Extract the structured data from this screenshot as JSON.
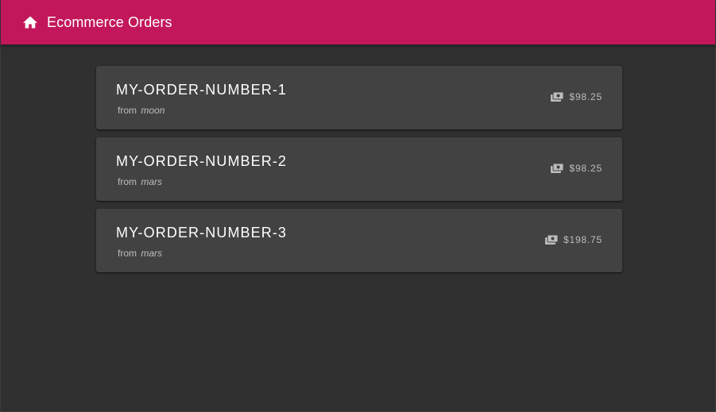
{
  "toolbar": {
    "title": "Ecommerce Orders",
    "icon": "home-icon",
    "color": "#c2185b"
  },
  "orders": [
    {
      "number": "MY-ORDER-NUMBER-1",
      "from_label": "from",
      "origin": "moon",
      "price": "$98.25",
      "icon": "money-icon"
    },
    {
      "number": "MY-ORDER-NUMBER-2",
      "from_label": "from",
      "origin": "mars",
      "price": "$98.25",
      "icon": "money-icon"
    },
    {
      "number": "MY-ORDER-NUMBER-3",
      "from_label": "from",
      "origin": "mars",
      "price": "$198.75",
      "icon": "money-icon"
    }
  ],
  "colors": {
    "background": "#303030",
    "card": "#424242",
    "text_primary": "#ffffff",
    "text_secondary": "#bdbdbd"
  }
}
